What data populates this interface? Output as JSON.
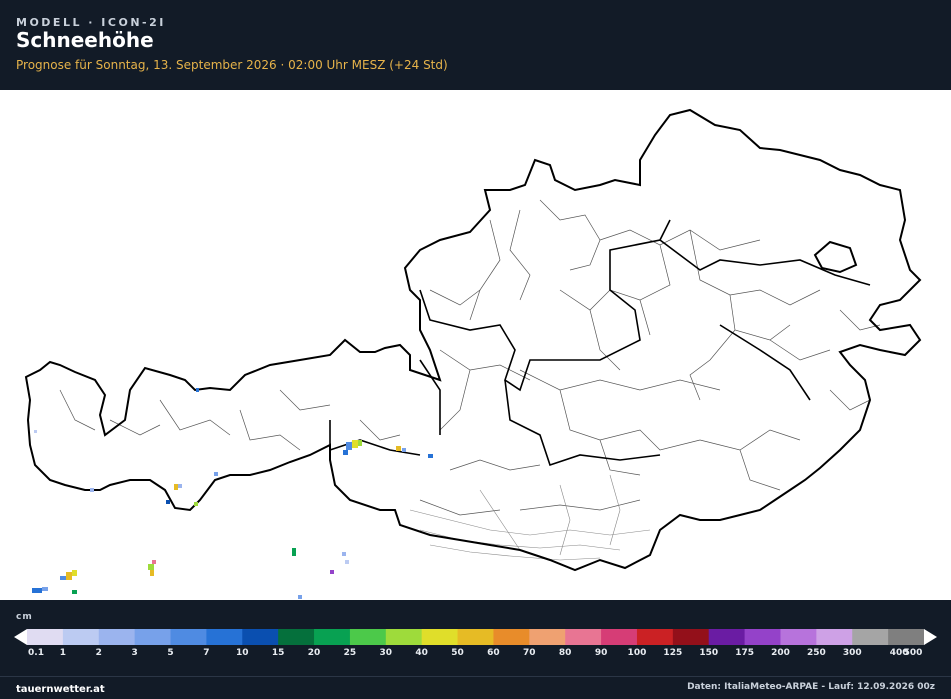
{
  "header": {
    "model_label": "MODELL · ICON-2I",
    "title": "Schneehöhe",
    "subtitle": "Prognose für Sonntag, 13. September 2026 · 02:00 Uhr MESZ  (+24 Std)"
  },
  "legend": {
    "unit": "cm",
    "ticks": [
      "0.1",
      "1",
      "2",
      "3",
      "5",
      "7",
      "10",
      "15",
      "20",
      "25",
      "30",
      "40",
      "50",
      "60",
      "70",
      "80",
      "90",
      "100",
      "125",
      "150",
      "175",
      "200",
      "250",
      "300",
      "400",
      "500"
    ],
    "colors": [
      "#e0dcf2",
      "#bccbf2",
      "#9bb4ee",
      "#77a1ea",
      "#4f8be2",
      "#2672d6",
      "#0a4fb0",
      "#05703c",
      "#08a152",
      "#4cc94a",
      "#9edb3b",
      "#e0de2a",
      "#e6bb25",
      "#e88c2a",
      "#efa171",
      "#e87593",
      "#d63d76",
      "#cb2124",
      "#93101a",
      "#6a1ca3",
      "#9442c9",
      "#b773dc",
      "#cea1e6",
      "#a5a5a5",
      "#7f7f7f"
    ]
  },
  "footer": {
    "source_left": "tauernwetter.at",
    "source_right": "Daten: ItaliaMeteo-ARPAE - Lauf: 12.09.2026 00z"
  }
}
